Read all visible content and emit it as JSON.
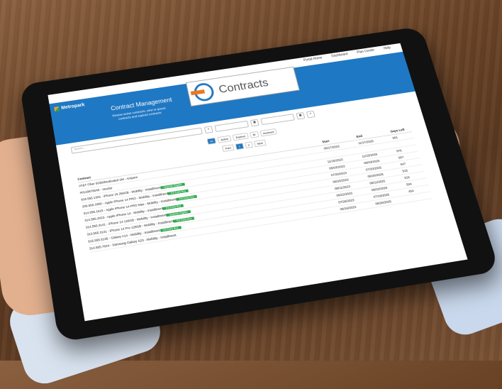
{
  "nav": [
    "Portal Home",
    "Dashboard",
    "Plan Center",
    "Help"
  ],
  "brand": "Metropark",
  "header": {
    "title": "Contract Management",
    "subtitle": "Review active contracts, view in-queue contracts and expired contracts",
    "banner": "Contracts"
  },
  "search_placeholder": "Search...",
  "filters": [
    "All",
    "Active",
    "Expired",
    "IR",
    "Archived"
  ],
  "pager": [
    "Prev",
    "1",
    "2",
    "Next"
  ],
  "columns": [
    "Contract",
    "Start",
    "End",
    "Days Left"
  ],
  "rows": [
    {
      "contract": "AT&T Fiber 5Gbit/Dedicated 2M - Ampere",
      "start": "05/17/2023",
      "end": "11/17/2025",
      "days": "561",
      "tag": ""
    },
    {
      "contract": "#0129876545 - Vendor",
      "start": "",
      "end": "",
      "days": "",
      "tag": ""
    },
    {
      "contract": "918.555.1302 - iPhone 15 256GB - Mobility - Installment",
      "start": "11/15/2023",
      "end": "11/15/2026",
      "days": "976",
      "tag": "Upgrade Eligible"
    },
    {
      "contract": "206.555.3300 - Apple iPhone 14 PRO - Mobility - Installment",
      "start": "05/03/2023",
      "end": "05/03/2025",
      "days": "557",
      "tag": "Est Early Buy"
    },
    {
      "contract": "314.555.1515 - Apple iPhone 14 PRO Max - Mobility - Installment",
      "start": "07/20/2023",
      "end": "07/20/2025",
      "days": "547",
      "tag": "Est Early Buy"
    },
    {
      "contract": "314.555.2023 - Apple iPhone 14 - Mobility - Installment",
      "start": "06/20/2023",
      "end": "06/20/2025",
      "days": "515",
      "tag": "Est Early Buy"
    },
    {
      "contract": "314.555.3141 - iPhone 14 128GB - Mobility - Installment",
      "start": "08/11/2023",
      "end": "08/11/2025",
      "days": "515",
      "tag": "Upgrade Eligible"
    },
    {
      "contract": "313.555.3141 - iPhone 14 Pro 128GB - Mobility - Installment",
      "start": "06/22/2023",
      "end": "06/22/2025",
      "days": "504",
      "tag": "Est Early Buy"
    },
    {
      "contract": "615.555.5135 - Galaxy A14 - Mobility - Installment",
      "start": "07/26/2023",
      "end": "07/19/2025",
      "days": "454",
      "tag": "Est Early Buy"
    },
    {
      "contract": "314.555.7624 - Samsung Galaxy S23 - Mobility - Installment",
      "start": "06/16/2023",
      "end": "06/26/2025",
      "days": "",
      "tag": ""
    }
  ],
  "colors": {
    "brand_blue": "#1f78c3",
    "accent_orange": "#e97a24",
    "tag_green": "#2fa84f"
  }
}
